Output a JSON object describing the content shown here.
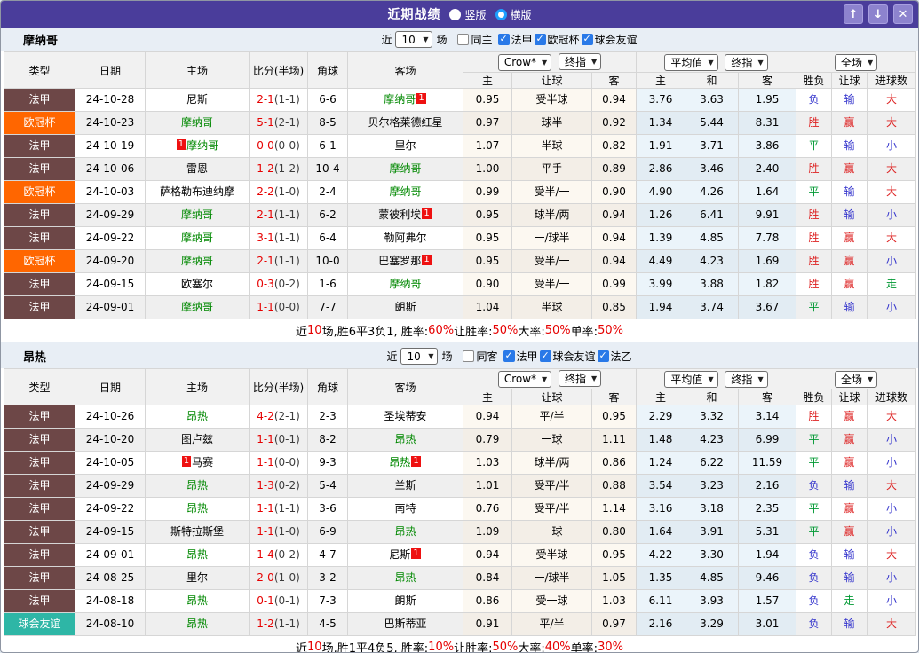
{
  "titlebar": {
    "title": "近期战绩",
    "radio_options": [
      {
        "label": "竖版",
        "selected": false
      },
      {
        "label": "横版",
        "selected": true
      }
    ],
    "buttons": {
      "up": "↑",
      "down": "↓",
      "close": "✕"
    }
  },
  "icons": {
    "dropdown_arrow": "▼",
    "check": "✓"
  },
  "table_header": {
    "static_cols": [
      "类型",
      "日期",
      "主场",
      "比分(半场)",
      "角球",
      "客场"
    ],
    "odds_group": {
      "select1": "Crow*",
      "select2": "终指",
      "subcols": [
        "主",
        "让球",
        "客"
      ]
    },
    "avg_group": {
      "select1": "平均值",
      "select2": "终指",
      "subcols": [
        "主",
        "和",
        "客"
      ]
    },
    "full_group": {
      "select": "全场",
      "subcols": [
        "胜负",
        "让球",
        "进球数"
      ]
    }
  },
  "colors": {
    "titlebar_bg": "#4a3d9b",
    "type_法甲": "#6d4747",
    "type_欧冠杯": "#ff6600",
    "type_球会友谊": "#2eb6a6",
    "focus_team": "#008800",
    "score_red": "#e60000",
    "badge_bg": "#ee1111",
    "result_win": "#dd2222",
    "result_draw": "#009933",
    "result_lose": "#3333cc"
  },
  "result_color_map": {
    "胜": "win",
    "平": "draw",
    "负": "lose",
    "赢": "win",
    "输": "lose",
    "走": "draw",
    "大": "win",
    "小": "lose"
  },
  "sections": [
    {
      "team": "摩纳哥",
      "filter": {
        "prefix": "近",
        "count": "10",
        "suffix": "场",
        "same_side": {
          "label": "同主",
          "checked": false
        },
        "leagues": [
          {
            "label": "法甲",
            "checked": true
          },
          {
            "label": "欧冠杯",
            "checked": true
          },
          {
            "label": "球会友谊",
            "checked": true
          }
        ]
      },
      "rows": [
        {
          "type": "法甲",
          "date": "24-10-28",
          "home": {
            "name": "尼斯"
          },
          "score_ft": "2-1",
          "score_ht": "(1-1)",
          "corner": "6-6",
          "away": {
            "name": "摩纳哥",
            "focus": true,
            "badge_after": "1"
          },
          "odds": [
            "0.95",
            "受半球",
            "0.94"
          ],
          "avg": [
            "3.76",
            "3.63",
            "1.95"
          ],
          "result": [
            "负",
            "输",
            "大"
          ]
        },
        {
          "type": "欧冠杯",
          "date": "24-10-23",
          "home": {
            "name": "摩纳哥",
            "focus": true
          },
          "score_ft": "5-1",
          "score_ht": "(2-1)",
          "corner": "8-5",
          "away": {
            "name": "贝尔格莱德红星"
          },
          "odds": [
            "0.97",
            "球半",
            "0.92"
          ],
          "avg": [
            "1.34",
            "5.44",
            "8.31"
          ],
          "result": [
            "胜",
            "赢",
            "大"
          ]
        },
        {
          "type": "法甲",
          "date": "24-10-19",
          "home": {
            "name": "摩纳哥",
            "focus": true,
            "badge_before": "1"
          },
          "score_ft": "0-0",
          "score_ht": "(0-0)",
          "corner": "6-1",
          "away": {
            "name": "里尔"
          },
          "odds": [
            "1.07",
            "半球",
            "0.82"
          ],
          "avg": [
            "1.91",
            "3.71",
            "3.86"
          ],
          "result": [
            "平",
            "输",
            "小"
          ]
        },
        {
          "type": "法甲",
          "date": "24-10-06",
          "home": {
            "name": "雷恩"
          },
          "score_ft": "1-2",
          "score_ht": "(1-2)",
          "corner": "10-4",
          "away": {
            "name": "摩纳哥",
            "focus": true
          },
          "odds": [
            "1.00",
            "平手",
            "0.89"
          ],
          "avg": [
            "2.86",
            "3.46",
            "2.40"
          ],
          "result": [
            "胜",
            "赢",
            "大"
          ]
        },
        {
          "type": "欧冠杯",
          "date": "24-10-03",
          "home": {
            "name": "萨格勒布迪纳摩"
          },
          "score_ft": "2-2",
          "score_ht": "(1-0)",
          "corner": "2-4",
          "away": {
            "name": "摩纳哥",
            "focus": true
          },
          "odds": [
            "0.99",
            "受半/一",
            "0.90"
          ],
          "avg": [
            "4.90",
            "4.26",
            "1.64"
          ],
          "result": [
            "平",
            "输",
            "大"
          ]
        },
        {
          "type": "法甲",
          "date": "24-09-29",
          "home": {
            "name": "摩纳哥",
            "focus": true
          },
          "score_ft": "2-1",
          "score_ht": "(1-1)",
          "corner": "6-2",
          "away": {
            "name": "蒙彼利埃",
            "badge_after": "1"
          },
          "odds": [
            "0.95",
            "球半/两",
            "0.94"
          ],
          "avg": [
            "1.26",
            "6.41",
            "9.91"
          ],
          "result": [
            "胜",
            "输",
            "小"
          ]
        },
        {
          "type": "法甲",
          "date": "24-09-22",
          "home": {
            "name": "摩纳哥",
            "focus": true
          },
          "score_ft": "3-1",
          "score_ht": "(1-1)",
          "corner": "6-4",
          "away": {
            "name": "勒阿弗尔"
          },
          "odds": [
            "0.95",
            "一/球半",
            "0.94"
          ],
          "avg": [
            "1.39",
            "4.85",
            "7.78"
          ],
          "result": [
            "胜",
            "赢",
            "大"
          ]
        },
        {
          "type": "欧冠杯",
          "date": "24-09-20",
          "home": {
            "name": "摩纳哥",
            "focus": true
          },
          "score_ft": "2-1",
          "score_ht": "(1-1)",
          "corner": "10-0",
          "away": {
            "name": "巴塞罗那",
            "badge_after": "1"
          },
          "odds": [
            "0.95",
            "受半/一",
            "0.94"
          ],
          "avg": [
            "4.49",
            "4.23",
            "1.69"
          ],
          "result": [
            "胜",
            "赢",
            "小"
          ]
        },
        {
          "type": "法甲",
          "date": "24-09-15",
          "home": {
            "name": "欧塞尔"
          },
          "score_ft": "0-3",
          "score_ht": "(0-2)",
          "corner": "1-6",
          "away": {
            "name": "摩纳哥",
            "focus": true
          },
          "odds": [
            "0.90",
            "受半/一",
            "0.99"
          ],
          "avg": [
            "3.99",
            "3.88",
            "1.82"
          ],
          "result": [
            "胜",
            "赢",
            "走"
          ]
        },
        {
          "type": "法甲",
          "date": "24-09-01",
          "home": {
            "name": "摩纳哥",
            "focus": true
          },
          "score_ft": "1-1",
          "score_ht": "(0-0)",
          "corner": "7-7",
          "away": {
            "name": "朗斯"
          },
          "odds": [
            "1.04",
            "半球",
            "0.85"
          ],
          "avg": [
            "1.94",
            "3.74",
            "3.67"
          ],
          "result": [
            "平",
            "输",
            "小"
          ]
        }
      ],
      "summary": [
        {
          "t": "近"
        },
        {
          "t": "10",
          "red": true
        },
        {
          "t": "场,胜6平3负1, 胜率:"
        },
        {
          "t": "60%",
          "red": true
        },
        {
          "t": " 让胜率:"
        },
        {
          "t": "50%",
          "red": true
        },
        {
          "t": " 大率:"
        },
        {
          "t": "50%",
          "red": true
        },
        {
          "t": " 单率:"
        },
        {
          "t": "50%",
          "red": true
        }
      ]
    },
    {
      "team": "昂热",
      "filter": {
        "prefix": "近",
        "count": "10",
        "suffix": "场",
        "same_side": {
          "label": "同客",
          "checked": false
        },
        "leagues": [
          {
            "label": "法甲",
            "checked": true
          },
          {
            "label": "球会友谊",
            "checked": true
          },
          {
            "label": "法乙",
            "checked": true
          }
        ]
      },
      "rows": [
        {
          "type": "法甲",
          "date": "24-10-26",
          "home": {
            "name": "昂热",
            "focus": true
          },
          "score_ft": "4-2",
          "score_ht": "(2-1)",
          "corner": "2-3",
          "away": {
            "name": "圣埃蒂安"
          },
          "odds": [
            "0.94",
            "平/半",
            "0.95"
          ],
          "avg": [
            "2.29",
            "3.32",
            "3.14"
          ],
          "result": [
            "胜",
            "赢",
            "大"
          ]
        },
        {
          "type": "法甲",
          "date": "24-10-20",
          "home": {
            "name": "图卢兹"
          },
          "score_ft": "1-1",
          "score_ht": "(0-1)",
          "corner": "8-2",
          "away": {
            "name": "昂热",
            "focus": true
          },
          "odds": [
            "0.79",
            "一球",
            "1.11"
          ],
          "avg": [
            "1.48",
            "4.23",
            "6.99"
          ],
          "result": [
            "平",
            "赢",
            "小"
          ]
        },
        {
          "type": "法甲",
          "date": "24-10-05",
          "home": {
            "name": "马赛",
            "badge_before": "1"
          },
          "score_ft": "1-1",
          "score_ht": "(0-0)",
          "corner": "9-3",
          "away": {
            "name": "昂热",
            "focus": true,
            "badge_after": "1"
          },
          "odds": [
            "1.03",
            "球半/两",
            "0.86"
          ],
          "avg": [
            "1.24",
            "6.22",
            "11.59"
          ],
          "result": [
            "平",
            "赢",
            "小"
          ]
        },
        {
          "type": "法甲",
          "date": "24-09-29",
          "home": {
            "name": "昂热",
            "focus": true
          },
          "score_ft": "1-3",
          "score_ht": "(0-2)",
          "corner": "5-4",
          "away": {
            "name": "兰斯"
          },
          "odds": [
            "1.01",
            "受平/半",
            "0.88"
          ],
          "avg": [
            "3.54",
            "3.23",
            "2.16"
          ],
          "result": [
            "负",
            "输",
            "大"
          ]
        },
        {
          "type": "法甲",
          "date": "24-09-22",
          "home": {
            "name": "昂热",
            "focus": true
          },
          "score_ft": "1-1",
          "score_ht": "(1-1)",
          "corner": "3-6",
          "away": {
            "name": "南特"
          },
          "odds": [
            "0.76",
            "受平/半",
            "1.14"
          ],
          "avg": [
            "3.16",
            "3.18",
            "2.35"
          ],
          "result": [
            "平",
            "赢",
            "小"
          ]
        },
        {
          "type": "法甲",
          "date": "24-09-15",
          "home": {
            "name": "斯特拉斯堡"
          },
          "score_ft": "1-1",
          "score_ht": "(1-0)",
          "corner": "6-9",
          "away": {
            "name": "昂热",
            "focus": true
          },
          "odds": [
            "1.09",
            "一球",
            "0.80"
          ],
          "avg": [
            "1.64",
            "3.91",
            "5.31"
          ],
          "result": [
            "平",
            "赢",
            "小"
          ]
        },
        {
          "type": "法甲",
          "date": "24-09-01",
          "home": {
            "name": "昂热",
            "focus": true
          },
          "score_ft": "1-4",
          "score_ht": "(0-2)",
          "corner": "4-7",
          "away": {
            "name": "尼斯",
            "badge_after": "1"
          },
          "odds": [
            "0.94",
            "受半球",
            "0.95"
          ],
          "avg": [
            "4.22",
            "3.30",
            "1.94"
          ],
          "result": [
            "负",
            "输",
            "大"
          ]
        },
        {
          "type": "法甲",
          "date": "24-08-25",
          "home": {
            "name": "里尔"
          },
          "score_ft": "2-0",
          "score_ht": "(1-0)",
          "corner": "3-2",
          "away": {
            "name": "昂热",
            "focus": true
          },
          "odds": [
            "0.84",
            "一/球半",
            "1.05"
          ],
          "avg": [
            "1.35",
            "4.85",
            "9.46"
          ],
          "result": [
            "负",
            "输",
            "小"
          ]
        },
        {
          "type": "法甲",
          "date": "24-08-18",
          "home": {
            "name": "昂热",
            "focus": true
          },
          "score_ft": "0-1",
          "score_ht": "(0-1)",
          "corner": "7-3",
          "away": {
            "name": "朗斯"
          },
          "odds": [
            "0.86",
            "受一球",
            "1.03"
          ],
          "avg": [
            "6.11",
            "3.93",
            "1.57"
          ],
          "result": [
            "负",
            "走",
            "小"
          ]
        },
        {
          "type": "球会友谊",
          "date": "24-08-10",
          "home": {
            "name": "昂热",
            "focus": true
          },
          "score_ft": "1-2",
          "score_ht": "(1-1)",
          "corner": "4-5",
          "away": {
            "name": "巴斯蒂亚"
          },
          "odds": [
            "0.91",
            "平/半",
            "0.97"
          ],
          "avg": [
            "2.16",
            "3.29",
            "3.01"
          ],
          "result": [
            "负",
            "输",
            "大"
          ]
        }
      ],
      "summary": [
        {
          "t": "近"
        },
        {
          "t": "10",
          "red": true
        },
        {
          "t": "场,胜1平4负5, 胜率:"
        },
        {
          "t": "10%",
          "red": true
        },
        {
          "t": " 让胜率:"
        },
        {
          "t": "50%",
          "red": true
        },
        {
          "t": " 大率:"
        },
        {
          "t": "40%",
          "red": true
        },
        {
          "t": " 单率:"
        },
        {
          "t": "30%",
          "red": true
        }
      ]
    }
  ]
}
